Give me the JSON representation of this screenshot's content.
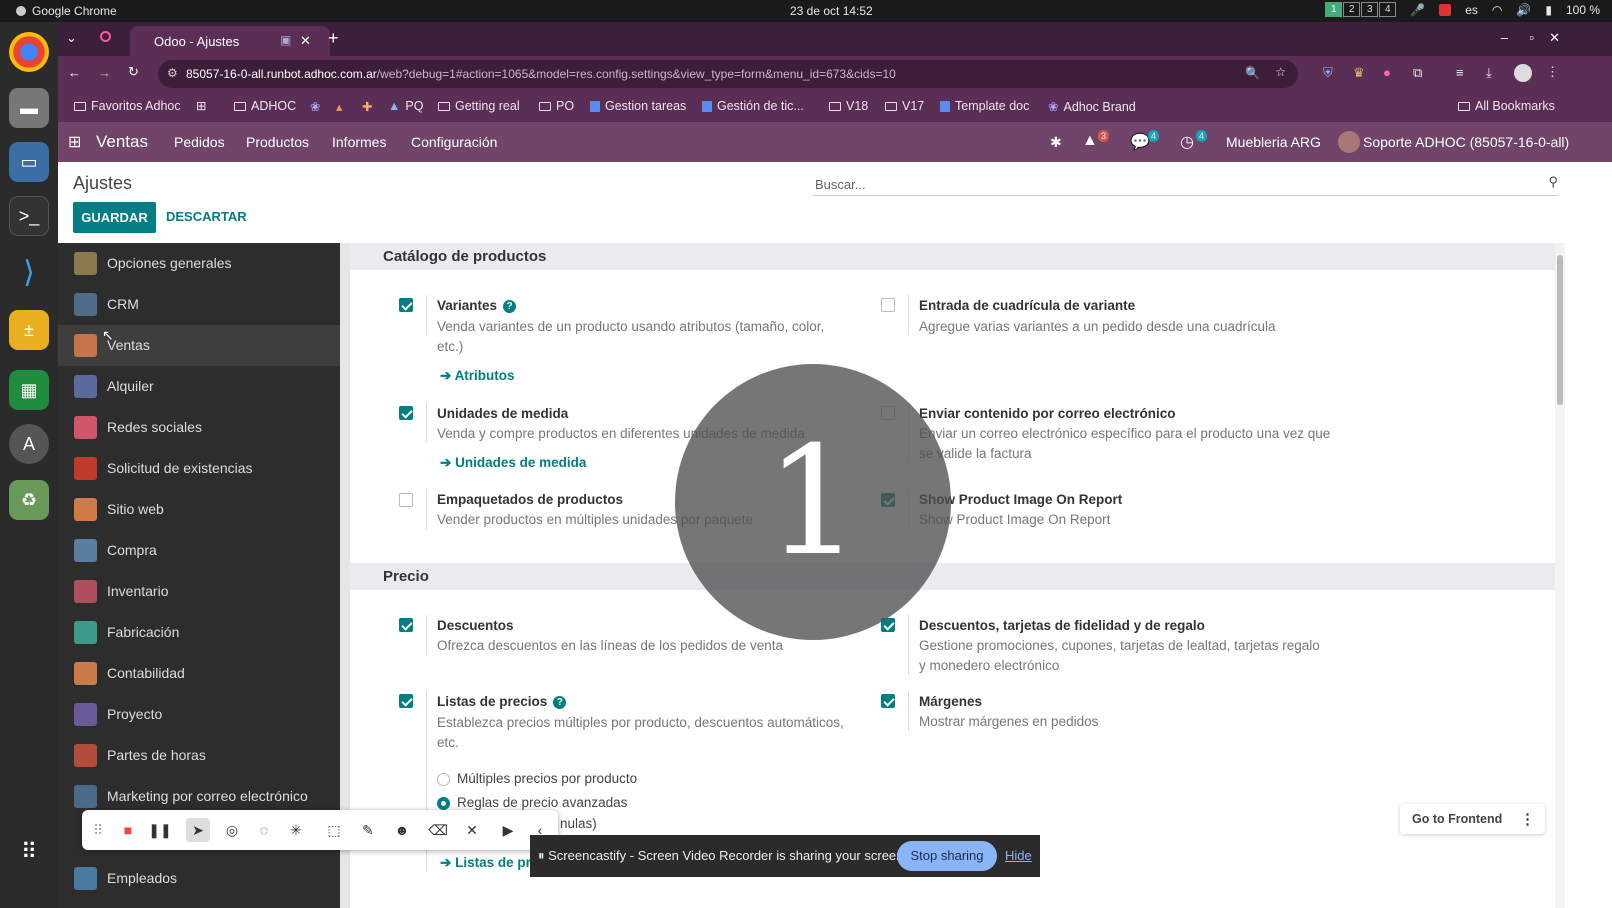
{
  "os": {
    "app_name": "Google Chrome",
    "clock": "23 de oct  14:52",
    "workspaces": [
      "1",
      "2",
      "3",
      "4"
    ],
    "lang": "es",
    "battery": "100 %"
  },
  "browser": {
    "tab_title": "Odoo - Ajustes",
    "url_host": "85057-16-0-all.runbot.adhoc.com.ar",
    "url_path": "/web?debug=1#action=1065&model=res.config.settings&view_type=form&menu_id=673&cids=10",
    "bookmarks": [
      "Favoritos Adhoc",
      "ADHOC",
      "PQ",
      "Getting real",
      "PO",
      "Gestion tareas",
      "Gestión de tic...",
      "V18",
      "V17",
      "Template doc",
      "Adhoc Brand"
    ],
    "all_bookmarks": "All Bookmarks"
  },
  "navbar": {
    "app": "Ventas",
    "menu": [
      "Pedidos",
      "Productos",
      "Informes",
      "Configuración"
    ],
    "alerts_count": "3",
    "messages_count": "4",
    "activities_count": "4",
    "company": "Muebleria ARG",
    "user": "Soporte ADHOC (85057-16-0-all)"
  },
  "control_panel": {
    "title": "Ajustes",
    "save": "GUARDAR",
    "discard": "DESCARTAR",
    "search_placeholder": "Buscar..."
  },
  "sidebar": {
    "items": [
      {
        "label": "Opciones generales",
        "color": "#8a7a4d"
      },
      {
        "label": "CRM",
        "color": "#4d6d8a"
      },
      {
        "label": "Ventas",
        "color": "#c6744c"
      },
      {
        "label": "Alquiler",
        "color": "#5a6a9a"
      },
      {
        "label": "Redes sociales",
        "color": "#d0566b"
      },
      {
        "label": "Solicitud de existencias",
        "color": "#c0392b"
      },
      {
        "label": "Sitio web",
        "color": "#d07a4a"
      },
      {
        "label": "Compra",
        "color": "#5a7ea0"
      },
      {
        "label": "Inventario",
        "color": "#b14e5e"
      },
      {
        "label": "Fabricación",
        "color": "#3d9a8b"
      },
      {
        "label": "Contabilidad",
        "color": "#c97c4a"
      },
      {
        "label": "Proyecto",
        "color": "#6a5a9a"
      },
      {
        "label": "Partes de horas",
        "color": "#b44c3e"
      },
      {
        "label": "Marketing por correo electrónico",
        "color": "#4a6a8a"
      },
      {
        "label": "Empleados",
        "color": "#4a7aa0"
      }
    ]
  },
  "sections": {
    "catalog": {
      "title": "Catálogo de productos",
      "variantes": {
        "title": "Variantes",
        "desc": "Venda variantes de un producto usando atributos (tamaño, color, etc.)",
        "link": "Atributos",
        "checked": true
      },
      "cuadricula": {
        "title": "Entrada de cuadrícula de variante",
        "desc": "Agregue varias variantes a un pedido desde una cuadrícula",
        "checked": false
      },
      "unidades": {
        "title": "Unidades de medida",
        "desc": "Venda y compre productos en diferentes unidades de medida",
        "link": "Unidades de medida",
        "checked": true
      },
      "correo": {
        "title": "Enviar contenido por correo electrónico",
        "desc": "Enviar un correo electrónico específico para el producto una vez que se valide la factura",
        "checked": false
      },
      "paquetes": {
        "title": "Empaquetados de productos",
        "desc": "Vender productos en múltiples unidades por paquete",
        "checked": false
      },
      "imagen": {
        "title": "Show Product Image On Report",
        "desc": "Show Product Image On Report",
        "checked": true
      }
    },
    "precio": {
      "title": "Precio",
      "descuentos": {
        "title": "Descuentos",
        "desc": "Ofrezca descuentos en las líneas de los pedidos de venta",
        "checked": true
      },
      "fidelidad": {
        "title": "Descuentos, tarjetas de fidelidad y de regalo",
        "desc": "Gestione promociones, cupones, tarjetas de lealtad, tarjetas regalo y monedero electrónico",
        "checked": true
      },
      "listas": {
        "title": "Listas de precios",
        "desc": "Establezca precios múltiples por producto, descuentos automáticos, etc.",
        "checked": true,
        "opt1": "Múltiples precios por producto",
        "opt2": "Reglas de precio avanzadas",
        "opt2b": "nulas)",
        "link": "Listas de pre"
      },
      "margenes": {
        "title": "Márgenes",
        "desc": "Mostrar márgenes en pedidos",
        "checked": true
      }
    }
  },
  "overlay": {
    "countdown": "1",
    "share_msg": "Screencastify - Screen Video Recorder is sharing your screen.",
    "stop_sharing": "Stop sharing",
    "hide": "Hide",
    "go_frontend": "Go to Frontend"
  },
  "colors": {
    "accent": "#017e84",
    "navbar": "#71456a",
    "chrome": "#5a2e55"
  }
}
